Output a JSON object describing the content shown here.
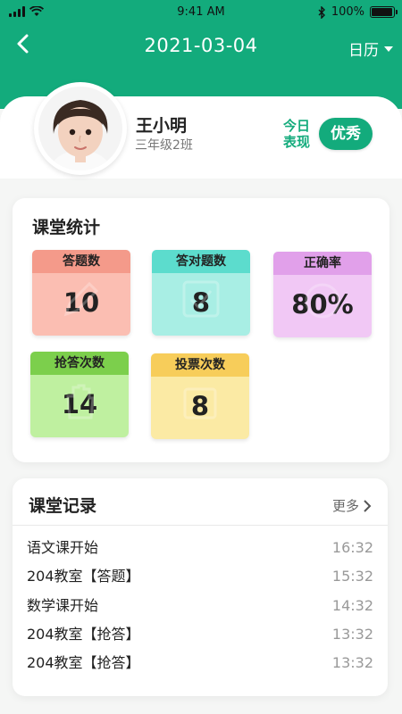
{
  "status_bar": {
    "time": "9:41 AM",
    "battery": "100%"
  },
  "nav": {
    "date": "2021-03-04",
    "calendar": "日历"
  },
  "profile": {
    "name": "王小明",
    "class": "三年级2班",
    "today_label": "今日表现",
    "rating": "优秀"
  },
  "stats": {
    "title": "课堂统计",
    "tiles": [
      {
        "label": "答题数",
        "value": "10",
        "head_color": "#f49a8a",
        "body_color": "#fbbeb2"
      },
      {
        "label": "答对题数",
        "value": "8",
        "head_color": "#5cdccd",
        "body_color": "#a8eee4"
      },
      {
        "label": "正确率",
        "value": "80%",
        "head_color": "#e1a0ea",
        "body_color": "#f1c8f5"
      },
      {
        "label": "抢答次数",
        "value": "14",
        "head_color": "#7ccf4c",
        "body_color": "#bff0a0"
      },
      {
        "label": "投票次数",
        "value": "8",
        "head_color": "#f7cd5a",
        "body_color": "#fbeaa4"
      }
    ]
  },
  "records": {
    "title": "课堂记录",
    "more": "更多",
    "items": [
      {
        "text": "语文课开始",
        "time": "16:32"
      },
      {
        "text": "204教室【答题】",
        "time": "15:32"
      },
      {
        "text": "数学课开始",
        "time": "14:32"
      },
      {
        "text": "204教室【抢答】",
        "time": "13:32"
      },
      {
        "text": "204教室【抢答】",
        "time": "13:32"
      }
    ]
  }
}
